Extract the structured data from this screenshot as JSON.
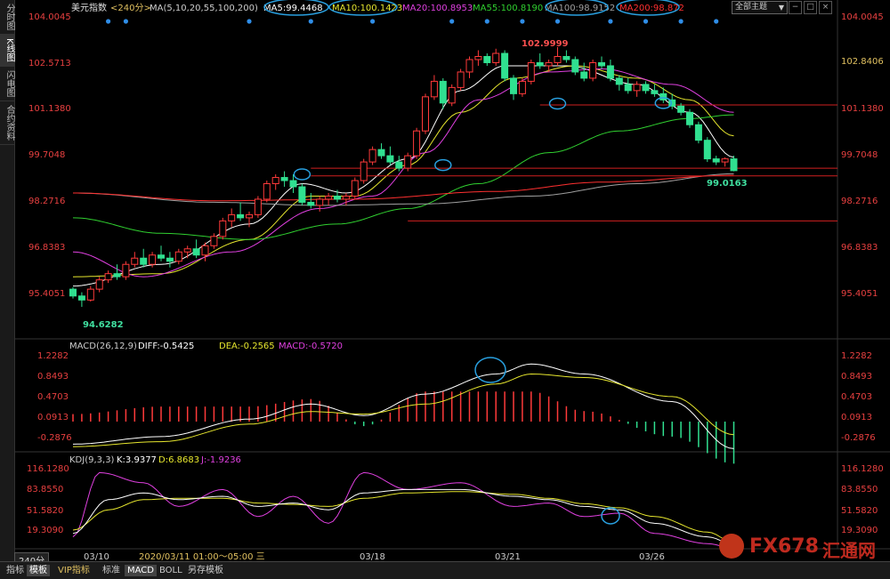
{
  "sidebar": {
    "tabs": [
      "分时图",
      "K线图",
      "闪电图",
      "合约资料"
    ],
    "active": 1
  },
  "toolbar": {
    "theme_select": "全部主题",
    "theme_arrow": "▼"
  },
  "main": {
    "title": "美元指数",
    "period": "<240分>",
    "ma_params": "MA(5,10,20,55,100,200)",
    "ma": [
      {
        "label": "MA5:99.4468",
        "color": "#ffffff"
      },
      {
        "label": "MA10:100.1423",
        "color": "#e6e62e"
      },
      {
        "label": "MA20:100.8953",
        "color": "#e040e0"
      },
      {
        "label": "MA55:100.8190",
        "color": "#30d030"
      },
      {
        "label": "MA100:98.9152",
        "color": "#a0a0a0"
      },
      {
        "label": "MA200:98.872",
        "color": "#ff3030"
      }
    ],
    "y_ticks": [
      "104.0045",
      "102.5713",
      "101.1380",
      "99.7048",
      "98.2716",
      "96.8383",
      "95.4051"
    ],
    "right_ticks": [
      "104.0045",
      "102.8406",
      "101.1380",
      "99.7048",
      "98.2716",
      "96.8383",
      "95.4051"
    ],
    "high_label": "102.9999",
    "low_label": "94.6282",
    "last_label": "99.0163"
  },
  "macd": {
    "title": "MACD(26,12,9)",
    "diff": "DIFF:-0.5425",
    "dea": "DEA:-0.2565",
    "macd": "MACD:-0.5720",
    "y_ticks": [
      "1.2282",
      "0.8493",
      "0.4703",
      "0.0913",
      "-0.2876"
    ]
  },
  "kdj": {
    "title": "KDJ(9,3,3)",
    "k": "K:3.9377",
    "d": "D:6.8683",
    "j": "J:-1.9236",
    "y_ticks": [
      "116.1280",
      "83.8550",
      "51.5820",
      "19.3090"
    ]
  },
  "x_axis": {
    "labels": [
      "03/10",
      "03/18",
      "03/21",
      "03/26"
    ],
    "cursor_label": "2020/03/11 01:00～05:00 三"
  },
  "bottom_bar": {
    "period": "240分",
    "tabs": [
      "指标",
      "模板",
      "VIP指标",
      "标准",
      "MACD",
      "BOLL",
      "另存模板"
    ]
  },
  "watermark": {
    "text": "FX678",
    "sub": "汇通网"
  },
  "chart_data": {
    "type": "candlestick",
    "ylim": [
      94.2,
      104.0045
    ],
    "ohlc": [
      [
        95.2,
        95.26,
        94.9,
        94.98
      ],
      [
        94.98,
        95.1,
        94.63,
        94.85
      ],
      [
        94.85,
        95.3,
        94.8,
        95.2
      ],
      [
        95.2,
        95.6,
        95.1,
        95.5
      ],
      [
        95.5,
        95.8,
        95.4,
        95.7
      ],
      [
        95.7,
        96.0,
        95.5,
        95.6
      ],
      [
        95.6,
        96.1,
        95.5,
        96.0
      ],
      [
        96.0,
        96.4,
        95.9,
        96.2
      ],
      [
        96.2,
        96.5,
        95.9,
        96.0
      ],
      [
        96.0,
        96.4,
        95.9,
        96.3
      ],
      [
        96.3,
        96.6,
        96.1,
        96.2
      ],
      [
        96.2,
        96.4,
        95.9,
        96.1
      ],
      [
        96.1,
        96.5,
        96.0,
        96.4
      ],
      [
        96.4,
        96.6,
        96.2,
        96.5
      ],
      [
        96.5,
        96.8,
        96.2,
        96.3
      ],
      [
        96.3,
        96.7,
        96.1,
        96.6
      ],
      [
        96.6,
        97.0,
        96.5,
        96.9
      ],
      [
        96.9,
        97.5,
        96.8,
        97.4
      ],
      [
        97.4,
        97.8,
        97.2,
        97.6
      ],
      [
        97.6,
        98.0,
        97.4,
        97.5
      ],
      [
        97.5,
        97.7,
        97.2,
        97.6
      ],
      [
        97.6,
        98.2,
        97.5,
        98.1
      ],
      [
        98.1,
        98.7,
        98.0,
        98.6
      ],
      [
        98.6,
        98.9,
        98.4,
        98.8
      ],
      [
        98.8,
        99.0,
        98.5,
        98.7
      ],
      [
        98.7,
        98.9,
        98.3,
        98.5
      ],
      [
        98.5,
        98.6,
        97.9,
        98.0
      ],
      [
        98.0,
        98.3,
        97.8,
        97.9
      ],
      [
        97.9,
        98.2,
        97.7,
        98.1
      ],
      [
        98.1,
        98.3,
        97.9,
        98.2
      ],
      [
        98.2,
        98.4,
        98.0,
        98.1
      ],
      [
        98.1,
        98.3,
        97.9,
        98.2
      ],
      [
        98.2,
        98.8,
        98.1,
        98.7
      ],
      [
        98.7,
        99.4,
        98.6,
        99.3
      ],
      [
        99.3,
        99.8,
        99.2,
        99.7
      ],
      [
        99.7,
        99.9,
        99.4,
        99.5
      ],
      [
        99.5,
        99.8,
        99.2,
        99.3
      ],
      [
        99.3,
        99.5,
        99.0,
        99.1
      ],
      [
        99.1,
        99.6,
        99.0,
        99.5
      ],
      [
        99.5,
        100.4,
        99.4,
        100.3
      ],
      [
        100.3,
        101.5,
        100.2,
        101.4
      ],
      [
        101.4,
        102.1,
        101.3,
        101.9
      ],
      [
        101.9,
        102.0,
        101.0,
        101.2
      ],
      [
        101.2,
        101.8,
        101.1,
        101.7
      ],
      [
        101.7,
        102.3,
        101.6,
        102.2
      ],
      [
        102.2,
        102.7,
        102.0,
        102.6
      ],
      [
        102.6,
        102.9,
        102.4,
        102.7
      ],
      [
        102.7,
        102.8,
        102.4,
        102.5
      ],
      [
        102.5,
        102.95,
        102.4,
        102.8
      ],
      [
        102.8,
        102.9,
        101.9,
        102.0
      ],
      [
        102.0,
        102.1,
        101.3,
        101.5
      ],
      [
        101.5,
        102.0,
        101.4,
        101.9
      ],
      [
        101.9,
        102.6,
        101.8,
        102.5
      ],
      [
        102.5,
        102.8,
        102.3,
        102.4
      ],
      [
        102.4,
        102.6,
        102.2,
        102.5
      ],
      [
        102.5,
        103.0,
        102.4,
        102.7
      ],
      [
        102.7,
        102.9,
        102.5,
        102.6
      ],
      [
        102.6,
        102.7,
        102.1,
        102.2
      ],
      [
        102.2,
        102.5,
        101.9,
        102.0
      ],
      [
        102.0,
        102.6,
        101.9,
        102.5
      ],
      [
        102.5,
        102.7,
        102.3,
        102.4
      ],
      [
        102.4,
        102.6,
        101.9,
        102.0
      ],
      [
        102.0,
        102.1,
        101.6,
        101.8
      ],
      [
        101.8,
        102.0,
        101.5,
        101.6
      ],
      [
        101.6,
        101.9,
        101.4,
        101.8
      ],
      [
        101.8,
        101.9,
        101.5,
        101.6
      ],
      [
        101.6,
        101.8,
        101.4,
        101.5
      ],
      [
        101.5,
        101.7,
        101.2,
        101.3
      ],
      [
        101.3,
        101.5,
        101.0,
        101.1
      ],
      [
        101.1,
        101.2,
        100.8,
        100.9
      ],
      [
        100.9,
        101.0,
        100.4,
        100.5
      ],
      [
        100.5,
        100.6,
        99.9,
        100.0
      ],
      [
        100.0,
        100.1,
        99.3,
        99.4
      ],
      [
        99.4,
        99.5,
        99.2,
        99.3
      ],
      [
        99.3,
        99.45,
        99.15,
        99.4
      ],
      [
        99.4,
        99.5,
        99.0,
        99.02
      ]
    ],
    "ma": {
      "MA5": {
        "color": "#ffffff",
        "anchors": [
          [
            0,
            95.3
          ],
          [
            10,
            96.0
          ],
          [
            20,
            97.3
          ],
          [
            26,
            98.6
          ],
          [
            31,
            98.3
          ],
          [
            38,
            99.4
          ],
          [
            44,
            101.6
          ],
          [
            49,
            102.4
          ],
          [
            56,
            102.4
          ],
          [
            64,
            101.8
          ],
          [
            70,
            100.9
          ],
          [
            75,
            99.45
          ]
        ]
      },
      "MA10": {
        "color": "#e6e62e",
        "anchors": [
          [
            0,
            95.6
          ],
          [
            10,
            95.7
          ],
          [
            20,
            96.8
          ],
          [
            27,
            98.2
          ],
          [
            32,
            98.2
          ],
          [
            38,
            99.2
          ],
          [
            44,
            100.9
          ],
          [
            50,
            102.0
          ],
          [
            57,
            102.4
          ],
          [
            64,
            102.0
          ],
          [
            70,
            101.3
          ],
          [
            75,
            100.14
          ]
        ]
      },
      "MA20": {
        "color": "#e040e0",
        "anchors": [
          [
            0,
            96.4
          ],
          [
            8,
            95.6
          ],
          [
            18,
            96.4
          ],
          [
            28,
            97.8
          ],
          [
            34,
            98.2
          ],
          [
            40,
            99.6
          ],
          [
            46,
            101.3
          ],
          [
            54,
            102.2
          ],
          [
            60,
            102.3
          ],
          [
            68,
            101.8
          ],
          [
            75,
            100.9
          ]
        ]
      },
      "MA55": {
        "color": "#30d030",
        "anchors": [
          [
            0,
            97.5
          ],
          [
            10,
            97.0
          ],
          [
            20,
            96.8
          ],
          [
            30,
            97.3
          ],
          [
            38,
            97.8
          ],
          [
            46,
            98.6
          ],
          [
            54,
            99.6
          ],
          [
            62,
            100.3
          ],
          [
            70,
            100.7
          ],
          [
            75,
            100.82
          ]
        ]
      },
      "MA100": {
        "color": "#a0a0a0",
        "anchors": [
          [
            0,
            98.3
          ],
          [
            16,
            98.0
          ],
          [
            28,
            97.9
          ],
          [
            40,
            97.95
          ],
          [
            52,
            98.2
          ],
          [
            64,
            98.6
          ],
          [
            75,
            98.92
          ]
        ]
      },
      "MA200": {
        "color": "#ff3030",
        "anchors": [
          [
            0,
            98.3
          ],
          [
            16,
            98.05
          ],
          [
            32,
            98.1
          ],
          [
            48,
            98.35
          ],
          [
            60,
            98.65
          ],
          [
            75,
            98.87
          ]
        ]
      }
    },
    "hlines": [
      {
        "y": 101.138,
        "from": 53
      },
      {
        "y": 99.1,
        "from": 27
      },
      {
        "y": 98.85,
        "from": 27
      },
      {
        "y": 97.4,
        "from": 38
      }
    ],
    "markers": [
      4,
      6,
      20,
      27,
      34,
      43,
      47,
      51,
      55,
      61,
      65,
      69,
      73
    ],
    "circles": [
      [
        26,
        98.9
      ],
      [
        42,
        99.2
      ],
      [
        55,
        101.18
      ],
      [
        67,
        101.2
      ]
    ],
    "macd_ylim": [
      -0.55,
      1.35
    ],
    "macd": {
      "diff": [
        [
          0,
          -0.45
        ],
        [
          10,
          -0.3
        ],
        [
          20,
          0.05
        ],
        [
          27,
          0.35
        ],
        [
          33,
          0.12
        ],
        [
          40,
          0.55
        ],
        [
          48,
          0.95
        ],
        [
          52,
          1.15
        ],
        [
          58,
          0.95
        ],
        [
          68,
          0.4
        ],
        [
          75,
          -0.54
        ]
      ],
      "dea": [
        [
          0,
          -0.5
        ],
        [
          10,
          -0.4
        ],
        [
          20,
          -0.05
        ],
        [
          27,
          0.2
        ],
        [
          33,
          0.15
        ],
        [
          40,
          0.35
        ],
        [
          48,
          0.75
        ],
        [
          52,
          0.95
        ],
        [
          58,
          0.88
        ],
        [
          68,
          0.5
        ],
        [
          75,
          -0.26
        ]
      ]
    },
    "kdj_ylim": [
      0,
      125
    ],
    "kdj": {
      "k": [
        [
          0,
          20
        ],
        [
          4,
          70
        ],
        [
          8,
          80
        ],
        [
          12,
          70
        ],
        [
          17,
          75
        ],
        [
          21,
          60
        ],
        [
          25,
          65
        ],
        [
          29,
          55
        ],
        [
          33,
          80
        ],
        [
          38,
          85
        ],
        [
          44,
          85
        ],
        [
          50,
          75
        ],
        [
          54,
          70
        ],
        [
          58,
          60
        ],
        [
          62,
          55
        ],
        [
          66,
          35
        ],
        [
          72,
          15
        ],
        [
          75,
          4
        ]
      ],
      "d": [
        [
          0,
          25
        ],
        [
          4,
          55
        ],
        [
          8,
          70
        ],
        [
          12,
          72
        ],
        [
          17,
          72
        ],
        [
          21,
          65
        ],
        [
          25,
          63
        ],
        [
          29,
          60
        ],
        [
          33,
          72
        ],
        [
          38,
          80
        ],
        [
          44,
          82
        ],
        [
          50,
          78
        ],
        [
          54,
          72
        ],
        [
          58,
          64
        ],
        [
          62,
          58
        ],
        [
          66,
          45
        ],
        [
          72,
          22
        ],
        [
          75,
          7
        ]
      ],
      "j": [
        [
          0,
          15
        ],
        [
          3,
          110
        ],
        [
          8,
          95
        ],
        [
          12,
          60
        ],
        [
          17,
          85
        ],
        [
          21,
          45
        ],
        [
          25,
          75
        ],
        [
          29,
          35
        ],
        [
          33,
          110
        ],
        [
          38,
          85
        ],
        [
          44,
          95
        ],
        [
          50,
          60
        ],
        [
          54,
          65
        ],
        [
          58,
          45
        ],
        [
          62,
          50
        ],
        [
          66,
          20
        ],
        [
          72,
          5
        ],
        [
          75,
          -2
        ]
      ]
    }
  }
}
